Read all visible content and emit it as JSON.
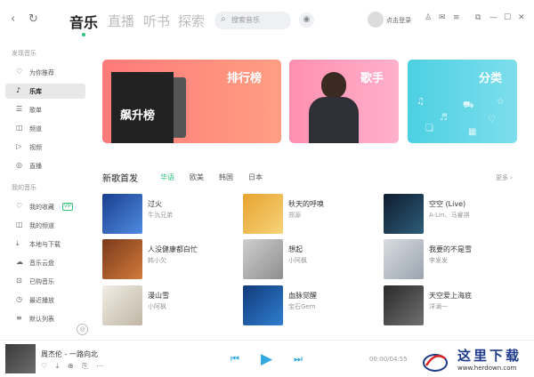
{
  "topbar": {
    "back": "‹",
    "refresh": "↻",
    "tabs": [
      "音乐",
      "直播",
      "听书",
      "探索"
    ],
    "search_placeholder": "搜索音乐",
    "login": "点击登录"
  },
  "sidebar": {
    "section1": "发现音乐",
    "items1": [
      "为你推荐",
      "乐库",
      "歌单",
      "频道",
      "视频",
      "直播"
    ],
    "section2": "我的音乐",
    "items2": [
      "我的收藏",
      "我的频道",
      "本地与下载",
      "音乐云盘",
      "已购音乐",
      "最近播放",
      "默认列表"
    ],
    "badge": "VIP"
  },
  "banners": {
    "b1": "排行榜",
    "b1_album": "飙升榜",
    "b2": "歌手",
    "b3": "分类"
  },
  "new_songs": {
    "title": "新歌首发",
    "lang_tabs": [
      "华语",
      "欧美",
      "韩国",
      "日本"
    ],
    "more": "更多 ›",
    "songs": [
      {
        "title": "过火",
        "artist": "牛氿兄弟"
      },
      {
        "title": "秋天的呼唤",
        "artist": "郑源"
      },
      {
        "title": "空空 (Live)",
        "artist": "A-Lin、马睿祺"
      },
      {
        "title": "人没健康都白忙",
        "artist": "韩小欠"
      },
      {
        "title": "想起",
        "artist": "小阿枫"
      },
      {
        "title": "我要的不是雪",
        "artist": "李发发"
      },
      {
        "title": "漫山雪",
        "artist": "小阿枫"
      },
      {
        "title": "血脉觉醒",
        "artist": "宝石Gem"
      },
      {
        "title": "天空爱上海底",
        "artist": "洋澜一"
      }
    ]
  },
  "player": {
    "now_playing": "周杰伦 - 一路向北",
    "time": "00:00/04:55"
  },
  "watermark": {
    "text": "这里下载",
    "url": "www.herdown.com"
  },
  "colors": {
    "accent": "#31c27c",
    "play": "#31a8e0"
  }
}
